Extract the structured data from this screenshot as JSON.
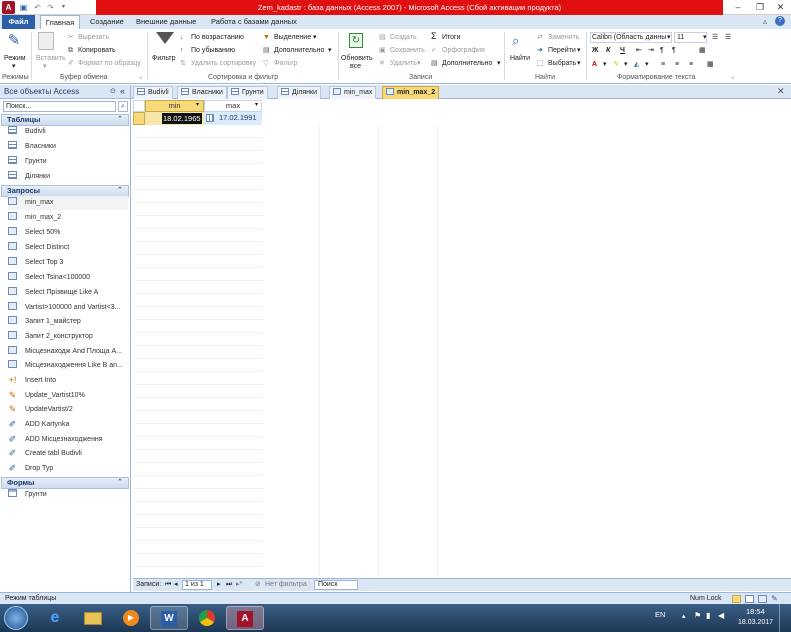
{
  "window": {
    "title": "Zem_kadastr : база данных (Access 2007)  -  Microsoft Access (Сбой активации продукта)"
  },
  "quick_access": {
    "undo": "↶",
    "redo": "↷"
  },
  "ribbon_tabs": [
    "Файл",
    "Главная",
    "Создание",
    "Внешние данные",
    "Работа с базами данных"
  ],
  "ribbon": {
    "modes": {
      "button": "Режим",
      "group": "Режимы"
    },
    "clipboard": {
      "paste": "Вставить",
      "cut": "Вырезать",
      "copy": "Копировать",
      "format": "Формат по образцу",
      "group": "Буфер обмена"
    },
    "sort": {
      "filter": "Фильтр",
      "asc": "По возрастанию",
      "desc": "По убыванию",
      "remove": "Удалить сортировку",
      "selection": "Выделение",
      "advanced": "Дополнительно",
      "toggle": "Фильтр",
      "group": "Сортировка и фильтр"
    },
    "records": {
      "refresh": "Обновить",
      "refresh2": "все",
      "new": "Создать",
      "save": "Сохранить",
      "delete": "Удалить",
      "totals": "Итоги",
      "spelling": "Орфография",
      "more": "Дополнительно",
      "group": "Записи"
    },
    "find": {
      "find": "Найти",
      "replace": "Заменить",
      "goto": "Перейти",
      "select": "Выбрать",
      "group": "Найти"
    },
    "text": {
      "font": "Calibri (Область данны",
      "size": "11",
      "group": "Форматирование текста"
    }
  },
  "doc_tabs": [
    "Budivli",
    "Власники",
    "Грунти",
    "Ділянки",
    "min_max",
    "min_max_2"
  ],
  "nav": {
    "header": "Все объекты Access",
    "search_placeholder": "Поиск...",
    "sections": {
      "tables": {
        "label": "Таблицы",
        "items": [
          "Budivli",
          "Власники",
          "Грунти",
          "Ділянки"
        ]
      },
      "queries": {
        "label": "Запросы",
        "items": [
          "min_max",
          "min_max_2",
          "Select 50%",
          "Select Distinct",
          "Select Top 3",
          "Select Tsina<100000",
          "Select Прізвище Like A",
          "Vartist>100000 and Vartist<3...",
          "Запит 1_майстер",
          "Запит 2_конструктор",
          "Місцезнаходж And Площа A...",
          "Місцезнаходження Like В an...",
          "Insert Into",
          "Update_Vartist10%",
          "UpdateVartist/2",
          "ADD Kartynka",
          "ADD Місцезнаходження",
          "Create tabl Budivli",
          "Drop Typ"
        ]
      },
      "forms": {
        "label": "Формы",
        "items": [
          "Грунти"
        ]
      }
    }
  },
  "grid": {
    "columns": [
      "min",
      "max"
    ],
    "rows": [
      {
        "min": "18.02.1965",
        "max": "17.02.1991"
      }
    ]
  },
  "record_nav": {
    "label": "Записи:",
    "position": "1 из 1",
    "filter": "Нет фильтра",
    "search": "Поиск"
  },
  "status": {
    "left": "Режим таблицы",
    "numlock": "Num Lock"
  },
  "taskbar": {
    "lang": "EN",
    "time": "18:54",
    "date": "18.03.2017"
  }
}
